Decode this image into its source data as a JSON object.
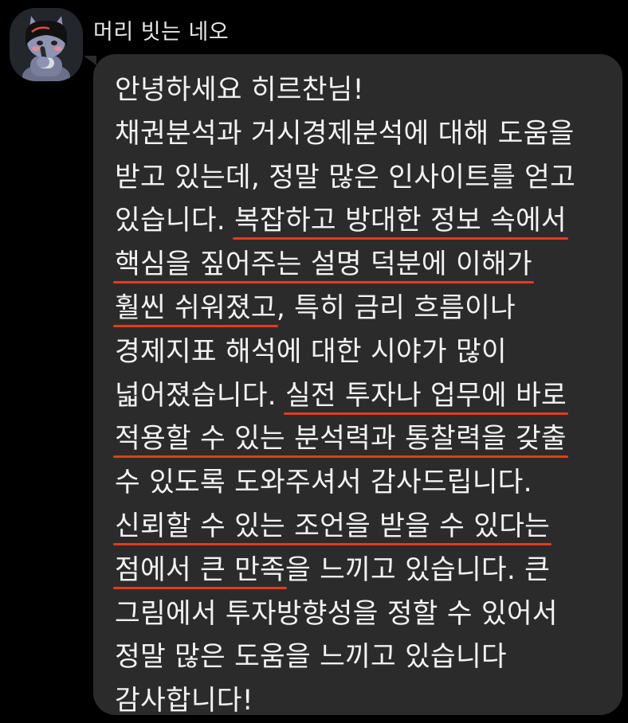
{
  "chat": {
    "sender_name": "머리 빗는 네오",
    "avatar_icon": "neo-character-icon",
    "bubble_color": "#2b2b2c",
    "highlight_color": "#e53a1f"
  },
  "message": {
    "lines": [
      [
        {
          "text": "안녕하세요 히르찬님!"
        }
      ],
      [
        {
          "text": "채권분석과 거시경제분석에 대해 도움을"
        }
      ],
      [
        {
          "text": "받고 있는데, 정말 많은 인사이트를 얻고"
        }
      ],
      [
        {
          "text": "있습니다. "
        },
        {
          "text": "복잡하고 방대한 정보 속에서",
          "highlight": true
        }
      ],
      [
        {
          "text": "핵심을 짚어주는 설명 덕분에 이해가",
          "highlight": true
        }
      ],
      [
        {
          "text": "훨씬 쉬워졌고",
          "highlight": true
        },
        {
          "text": ", 특히 금리 흐름이나"
        }
      ],
      [
        {
          "text": "경제지표 해석에 대한 시야가 많이"
        }
      ],
      [
        {
          "text": "넓어졌습니다. "
        },
        {
          "text": "실전 투자나 업무에 바로",
          "highlight": true
        }
      ],
      [
        {
          "text": "적용할 수 있는 분석력과 통찰력을 갖출",
          "highlight": true
        }
      ],
      [
        {
          "text": "수 있도록 도와주셔서 감사드립니다."
        }
      ],
      [
        {
          "text": "신뢰할 수 있는 조언을 받을 수 있다는",
          "highlight": true
        }
      ],
      [
        {
          "text": "점에서 큰 만족",
          "highlight": true
        },
        {
          "text": "을 느끼고 있습니다. 큰"
        }
      ],
      [
        {
          "text": "그림에서 투자방향성을 정할 수 있어서"
        }
      ],
      [
        {
          "text": "정말 많은 도움을 느끼고 있습니다"
        }
      ],
      [
        {
          "text": "감사합니다!"
        }
      ]
    ]
  }
}
